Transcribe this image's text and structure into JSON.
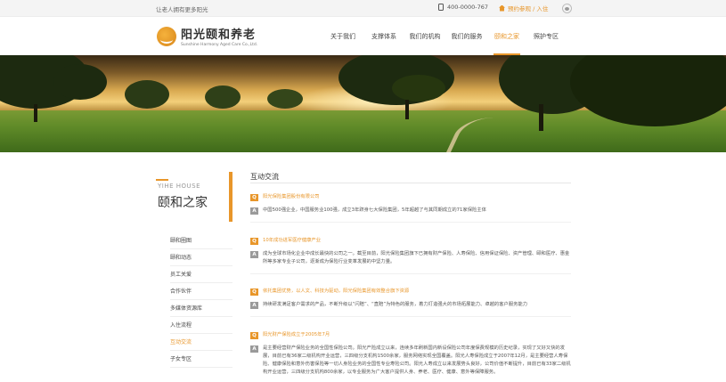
{
  "topbar": {
    "slogan": "让老人拥有更多阳光",
    "phone": "400-0000-767",
    "visit_link": "预约参观 / 入住",
    "phone_icon": "phone-icon",
    "visit_icon": "home-icon",
    "wechat_icon": "wechat-icon"
  },
  "header": {
    "logo_cn": "阳光颐和养老",
    "logo_en": "Sunshine Harmony Aged Care Co.,Ltd.",
    "nav": [
      "关于我们",
      "支撑体系",
      "我们的机构",
      "我们的服务",
      "颐和之家",
      "照护专区"
    ],
    "active_nav": "颐和之家"
  },
  "sidebar": {
    "title_en": "YIHE HOUSE",
    "title_cn": "颐和之家",
    "items": [
      "颐和圈图",
      "颐和动态",
      "员工关爱",
      "合作伙伴",
      "多媒体资源库",
      "入住流程",
      "互动交流",
      "子女专区"
    ],
    "active_item": "互动交流"
  },
  "main": {
    "title": "互动交流",
    "qa": [
      {
        "q_mark": "Q",
        "a_mark": "A",
        "question": "阳光保险集团股份有限公司",
        "answer": "中国500强企业，中国服务业100强，成立3年跻身七大保险集团，5年超越了与其同期成立的71家保险主体"
      },
      {
        "q_mark": "Q",
        "a_mark": "A",
        "question": "10年成功进军医疗健康产业",
        "answer": "成为全球市场化企业中成长最快的公司之一。截至目前，阳光保险集团旗下已拥有财产保险、人寿保险、信用保证保险、资产管理、颐和医疗、惠金所等多家专业子公司，逐渐成为保险行业变革发展的中坚力量。"
      },
      {
        "q_mark": "Q",
        "a_mark": "A",
        "question": "依托集团优势，以人文、科技为驱动，阳光保险集团有效整合旗下资源",
        "answer": "持续研发满足客户需求的产品，不断升级以“闪赔”、“直赔”为特色的服务，着力打造强大的市场拓展能力、卓越的客户服务能力"
      },
      {
        "q_mark": "Q",
        "a_mark": "A",
        "question": "阳光财产保险成立于2005年7月",
        "answer": "是主要经营财产保险业务的全国性保险公司。阳光产险成立以来，连续多年刷新国内新设保险公司年度保费规模的历史纪录，实现了又好又快的发展，目前已有36家二级机构开业运营，三四级分支机构1500余家，服务网络实现全国覆盖。阳光人寿保险成立于2007年12月，是主要经营人寿保险、健康保险和意外伤害保险等一切人身险业务的全国性专业寿险公司。阳光人寿成立以来发展势头良好，公司价值不断提升，目前已有33家二级机构开业运营，三四级分支机构800余家，以专业服务为广大客户提供人身、养老、医疗、健康、意外等保障服务。"
      }
    ]
  }
}
